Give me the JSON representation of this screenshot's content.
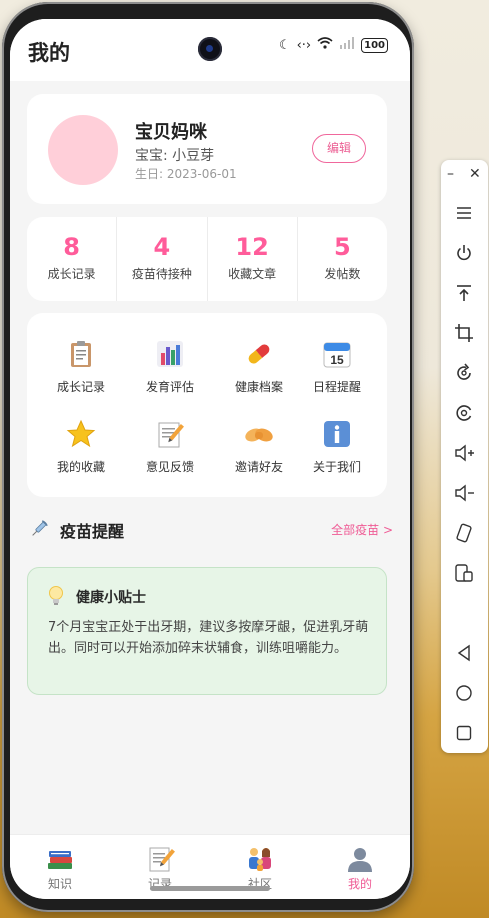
{
  "page": {
    "title": "我的"
  },
  "status_bar": {
    "battery": "100"
  },
  "profile": {
    "name": "宝贝妈咪",
    "baby": "宝宝: 小豆芽",
    "birthday": "生日: 2023-06-01",
    "edit_label": "编辑",
    "avatar_color": "#ffcfd9"
  },
  "stats": [
    {
      "value": "8",
      "label": "成长记录"
    },
    {
      "value": "4",
      "label": "疫苗待接种"
    },
    {
      "value": "12",
      "label": "收藏文章"
    },
    {
      "value": "5",
      "label": "发帖数"
    }
  ],
  "features": [
    {
      "label": "成长记录",
      "icon": "clipboard-icon"
    },
    {
      "label": "发育评估",
      "icon": "bar-chart-icon"
    },
    {
      "label": "健康档案",
      "icon": "pill-icon"
    },
    {
      "label": "日程提醒",
      "icon": "calendar-icon",
      "day": "15"
    },
    {
      "label": "我的收藏",
      "icon": "star-icon"
    },
    {
      "label": "意见反馈",
      "icon": "memo-icon"
    },
    {
      "label": "邀请好友",
      "icon": "handshake-icon"
    },
    {
      "label": "关于我们",
      "icon": "info-icon"
    }
  ],
  "vaccine_section": {
    "title": "疫苗提醒",
    "link": "全部疫苗 >"
  },
  "tip": {
    "title": "健康小贴士",
    "text": "7个月宝宝正处于出牙期，建议多按摩牙龈，促进乳牙萌出。同时可以开始添加碎末状辅食，训练咀嚼能力。"
  },
  "tabs": [
    {
      "label": "知识",
      "icon": "books-icon",
      "active": false
    },
    {
      "label": "记录",
      "icon": "memo-icon",
      "active": false
    },
    {
      "label": "社区",
      "icon": "family-icon",
      "active": false
    },
    {
      "label": "我的",
      "icon": "user-icon",
      "active": true
    }
  ],
  "colors": {
    "accent": "#ef5b95",
    "tip_bg": "#e7f5e7"
  }
}
